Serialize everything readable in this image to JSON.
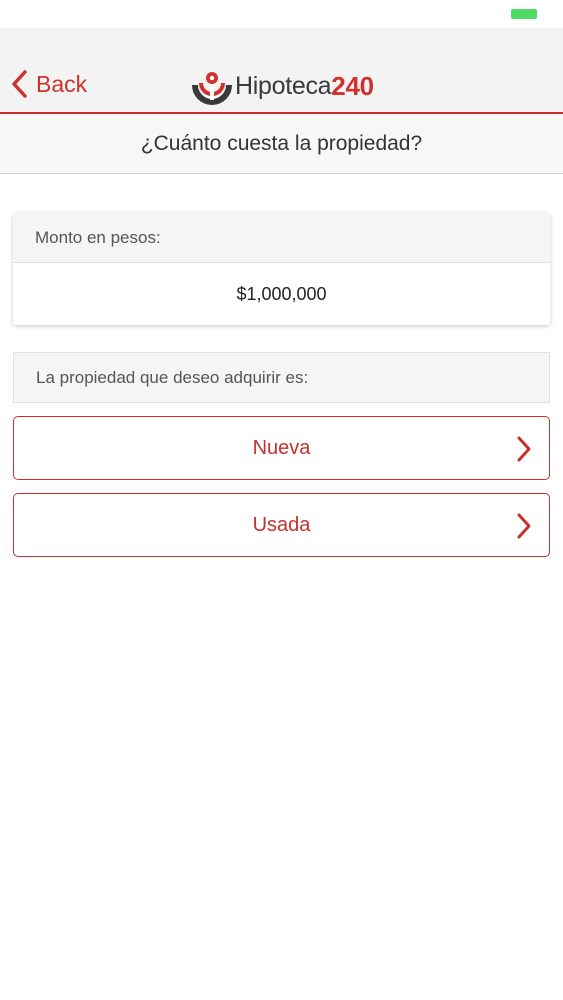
{
  "nav": {
    "back_label": "Back",
    "logo_text": "Hipoteca",
    "logo_number": "240"
  },
  "title": "¿Cuánto cuesta la propiedad?",
  "amount": {
    "label": "Monto en pesos:",
    "value": "$1,000,000"
  },
  "property_question": "La propiedad que deseo adquirir es:",
  "options": [
    {
      "label": "Nueva"
    },
    {
      "label": "Usada"
    }
  ],
  "colors": {
    "accent": "#c9302c",
    "battery": "#4cd964",
    "nav_background": "#f3f3f3"
  },
  "icons": [
    "chevron-left-icon",
    "hipoteca240-logo-icon",
    "chevron-right-icon",
    "battery-icon"
  ]
}
